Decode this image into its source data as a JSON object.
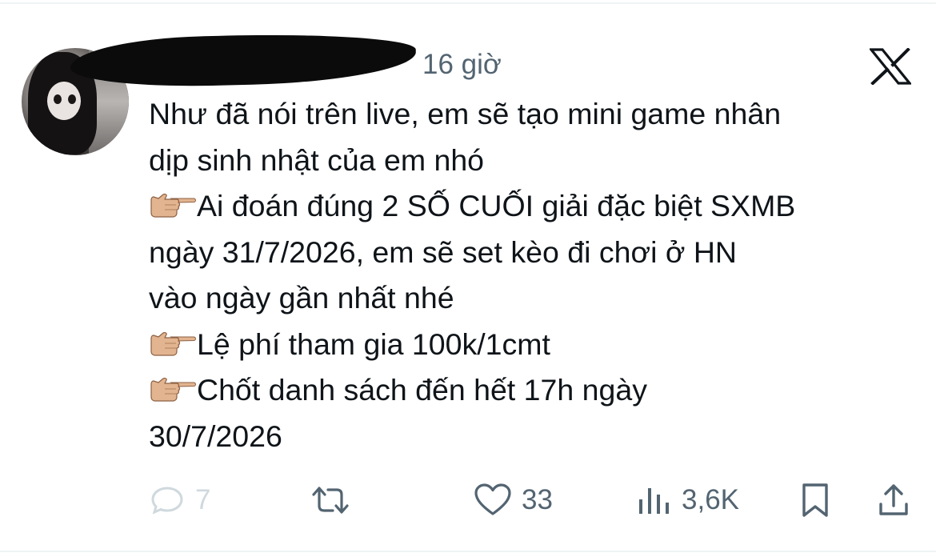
{
  "post": {
    "time": "16 giờ",
    "text_lines": [
      {
        "emoji": false,
        "text": "Như đã nói trên live, em sẽ tạo mini game nhân"
      },
      {
        "emoji": false,
        "text": "dịp sinh nhật của em nhó"
      },
      {
        "emoji": true,
        "text": "Ai đoán đúng 2 SỐ CUỐI giải đặc biệt SXMB"
      },
      {
        "emoji": false,
        "text": "ngày 31/7/2026, em sẽ set kèo đi chơi ở HN"
      },
      {
        "emoji": false,
        "text": "vào ngày gần nhất nhé"
      },
      {
        "emoji": true,
        "text": "Lệ phí tham gia 100k/1cmt"
      },
      {
        "emoji": true,
        "text": "Chốt danh sách đến hết 17h ngày"
      },
      {
        "emoji": false,
        "text": "30/7/2026"
      }
    ],
    "bullet_icon": "pointing-right-hand-emoji"
  },
  "actions": {
    "reply": {
      "icon": "reply-icon",
      "count": "7"
    },
    "retweet": {
      "icon": "retweet-icon",
      "count": ""
    },
    "like": {
      "icon": "heart-icon",
      "count": "33"
    },
    "views": {
      "icon": "views-icon",
      "count": "3,6K"
    },
    "bookmark": {
      "icon": "bookmark-icon"
    },
    "share": {
      "icon": "share-icon"
    }
  },
  "colors": {
    "text": "#0f1419",
    "muted": "#536471",
    "reply_muted": "#cfd9de",
    "divider": "#eff3f4"
  }
}
